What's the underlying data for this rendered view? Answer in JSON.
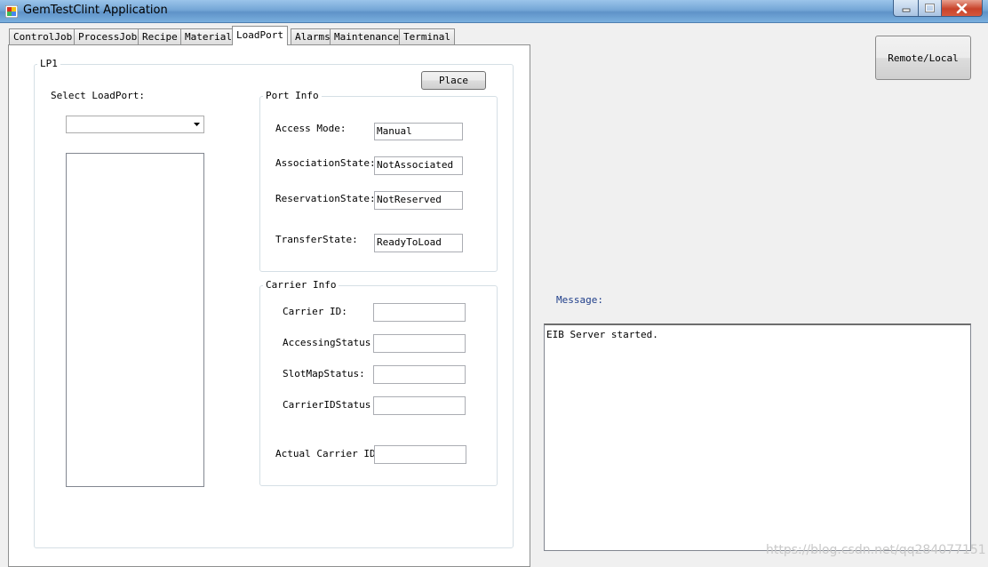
{
  "window": {
    "title": "GemTestClint Application"
  },
  "tabs": [
    {
      "label": "ControlJob"
    },
    {
      "label": "ProcessJob"
    },
    {
      "label": "Recipe"
    },
    {
      "label": "Material"
    },
    {
      "label": "LoadPort"
    },
    {
      "label": "Alarms"
    },
    {
      "label": "Maintenance"
    },
    {
      "label": "Terminal"
    }
  ],
  "active_tab": "LoadPort",
  "lp1": {
    "title": "LP1",
    "select_label": "Select LoadPort:",
    "select_value": "",
    "place_button": "Place",
    "port_info": {
      "title": "Port Info",
      "access_mode_label": "Access Mode:",
      "access_mode_value": "Manual",
      "association_label": "AssociationState:",
      "association_value": "NotAssociated",
      "reservation_label": "ReservationState:",
      "reservation_value": "NotReserved",
      "transfer_label": "TransferState:",
      "transfer_value": "ReadyToLoad"
    },
    "carrier_info": {
      "title": "Carrier Info",
      "carrier_id_label": "Carrier ID:",
      "carrier_id_value": "",
      "accessing_label": "AccessingStatus:",
      "accessing_value": "",
      "slotmap_label": "SlotMapStatus:",
      "slotmap_value": "",
      "carrieridstatus_label": "CarrierIDStatus:",
      "carrieridstatus_value": "",
      "actual_carrier_label": "Actual Carrier ID:",
      "actual_carrier_value": ""
    }
  },
  "remote_local_button": "Remote/Local",
  "message": {
    "label": "Message:",
    "text": "EIB Server started."
  },
  "watermark": "https://blog.csdn.net/qq284077151",
  "colors": {
    "titlebar": "#74a6d6",
    "message_label": "#1f3e8a",
    "close_button": "#c8432b"
  }
}
